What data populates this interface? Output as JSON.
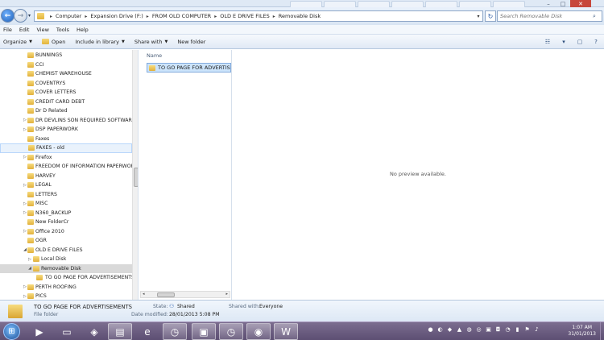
{
  "address": {
    "crumbs": [
      "Computer",
      "Expansion Drive (F:)",
      "FROM OLD COMPUTER",
      "OLD E DRIVE FILES",
      "Removable Disk"
    ]
  },
  "search": {
    "placeholder": "Search Removable Disk"
  },
  "menu": [
    "File",
    "Edit",
    "View",
    "Tools",
    "Help"
  ],
  "toolbar": {
    "organize": "Organize",
    "open": "Open",
    "include": "Include in library",
    "share": "Share with",
    "new_folder": "New folder"
  },
  "tree": [
    {
      "label": "BUNNINGS",
      "depth": 1,
      "expander": ""
    },
    {
      "label": "CCI",
      "depth": 1,
      "expander": ""
    },
    {
      "label": "CHEMIST WAREHOUSE",
      "depth": 1,
      "expander": ""
    },
    {
      "label": "COVENTRYS",
      "depth": 1,
      "expander": ""
    },
    {
      "label": "COVER LETTERS",
      "depth": 1,
      "expander": ""
    },
    {
      "label": "CREDIT CARD DEBT",
      "depth": 1,
      "expander": ""
    },
    {
      "label": "Dr D Related",
      "depth": 1,
      "expander": ""
    },
    {
      "label": "DR DEVLINS SON REQUIRED SOFTWARE",
      "depth": 1,
      "expander": "▷"
    },
    {
      "label": "DSP PAPERWORK",
      "depth": 1,
      "expander": "▷"
    },
    {
      "label": "Faxes",
      "depth": 1,
      "expander": ""
    },
    {
      "label": "FAXES - old",
      "depth": 1,
      "expander": "",
      "state": "hover"
    },
    {
      "label": "Firefox",
      "depth": 1,
      "expander": "▷"
    },
    {
      "label": "FREEDOM OF INFORMATION PAPERWORK",
      "depth": 1,
      "expander": ""
    },
    {
      "label": "HARVEY",
      "depth": 1,
      "expander": ""
    },
    {
      "label": "LEGAL",
      "depth": 1,
      "expander": "▷"
    },
    {
      "label": "LETTERS",
      "depth": 1,
      "expander": ""
    },
    {
      "label": "MISC",
      "depth": 1,
      "expander": "▷"
    },
    {
      "label": "N360_BACKUP",
      "depth": 1,
      "expander": "▷"
    },
    {
      "label": "New FolderCr",
      "depth": 1,
      "expander": ""
    },
    {
      "label": "Office 2010",
      "depth": 1,
      "expander": "▷"
    },
    {
      "label": "OGR",
      "depth": 1,
      "expander": ""
    },
    {
      "label": "OLD E DRIVE FILES",
      "depth": 1,
      "expander": "◢"
    },
    {
      "label": "Local Disk",
      "depth": 2,
      "expander": "▷"
    },
    {
      "label": "Removable Disk",
      "depth": 2,
      "expander": "◢",
      "state": "selected"
    },
    {
      "label": "TO GO PAGE FOR ADVERTISEMENTS",
      "depth": 3,
      "expander": ""
    },
    {
      "label": "PERTH ROOFING",
      "depth": 1,
      "expander": "▷"
    },
    {
      "label": "PICS",
      "depth": 1,
      "expander": "▷"
    }
  ],
  "filelist": {
    "column_name": "Name",
    "items": [
      "TO GO PAGE FOR ADVERTISEM"
    ]
  },
  "preview": {
    "message": "No preview available."
  },
  "details": {
    "name": "TO GO PAGE FOR ADVERTISEMENTS",
    "type": "File folder",
    "state_label": "State:",
    "state_value": "Shared",
    "modified_label": "Date modified:",
    "modified_value": "28/01/2013 5:08 PM",
    "shared_label": "Shared with:",
    "shared_value": "Everyone"
  },
  "taskbar": {
    "time": "1:07 AM",
    "date": "31/01/2013"
  },
  "colors": {
    "selection": "#cce4fb",
    "taskbar": "#6b5d80",
    "folder": "#e9c253"
  }
}
